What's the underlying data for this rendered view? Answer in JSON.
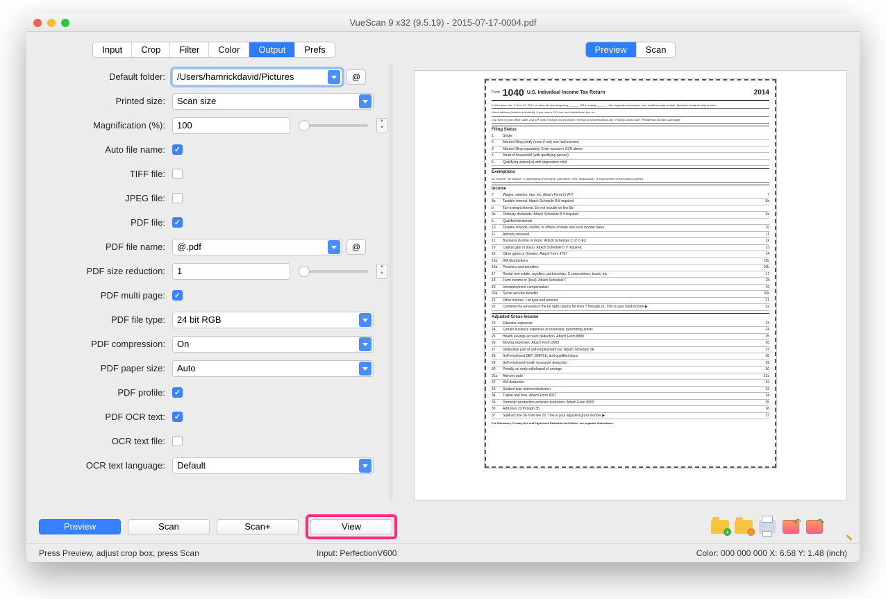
{
  "window": {
    "title": "VueScan 9 x32 (9.5.19) - 2015-07-17-0004.pdf"
  },
  "left_tabs": [
    "Input",
    "Crop",
    "Filter",
    "Color",
    "Output",
    "Prefs"
  ],
  "left_tab_active": 4,
  "right_tabs": [
    "Preview",
    "Scan"
  ],
  "right_tab_active": 0,
  "form": {
    "default_folder": {
      "label": "Default folder:",
      "value": "/Users/hamrickdavid/Pictures"
    },
    "printed_size": {
      "label": "Printed size:",
      "value": "Scan size"
    },
    "magnification": {
      "label": "Magnification (%):",
      "value": "100"
    },
    "auto_file_name": {
      "label": "Auto file name:",
      "checked": true
    },
    "tiff_file": {
      "label": "TIFF file:",
      "checked": false
    },
    "jpeg_file": {
      "label": "JPEG file:",
      "checked": false
    },
    "pdf_file": {
      "label": "PDF file:",
      "checked": true
    },
    "pdf_file_name": {
      "label": "PDF file name:",
      "value": "@.pdf"
    },
    "pdf_size_red": {
      "label": "PDF size reduction:",
      "value": "1"
    },
    "pdf_multi_page": {
      "label": "PDF multi page:",
      "checked": true
    },
    "pdf_file_type": {
      "label": "PDF file type:",
      "value": "24 bit RGB"
    },
    "pdf_compress": {
      "label": "PDF compression:",
      "value": "On"
    },
    "pdf_paper_size": {
      "label": "PDF paper size:",
      "value": "Auto"
    },
    "pdf_profile": {
      "label": "PDF profile:",
      "checked": true
    },
    "pdf_ocr_text": {
      "label": "PDF OCR text:",
      "checked": true
    },
    "ocr_text_file": {
      "label": "OCR text file:",
      "checked": false
    },
    "ocr_lang": {
      "label": "OCR text language:",
      "value": "Default"
    }
  },
  "buttons": {
    "preview": "Preview",
    "scan": "Scan",
    "scanplus": "Scan+",
    "view": "View"
  },
  "status": {
    "left": "Press Preview, adjust crop box, press Scan",
    "mid": "Input: PerfectionV600",
    "right": "Color: 000 000 000    X:   6.58   Y:   1.48 (inch)"
  },
  "doc": {
    "form_no": "1040",
    "title": "U.S. Individual Income Tax Return",
    "year": "2014",
    "sections": {
      "filing": "Filing Status",
      "exemptions": "Exemptions",
      "income": "Income",
      "agi": "Adjusted Gross Income"
    },
    "filing_opts": [
      "Single",
      "Married filing jointly (even if only one had income)",
      "Married filing separately. Enter spouse's SSN above",
      "Head of household (with qualifying person)",
      "Qualifying widow(er) with dependent child"
    ],
    "income_lines": [
      [
        "7",
        "Wages, salaries, tips, etc. Attach Form(s) W-2",
        "7"
      ],
      [
        "8a",
        "Taxable interest. Attach Schedule B if required",
        "8a"
      ],
      [
        "b",
        "Tax-exempt interest. Do not include on line 8a",
        ""
      ],
      [
        "9a",
        "Ordinary dividends. Attach Schedule B if required",
        "9a"
      ],
      [
        "b",
        "Qualified dividends",
        ""
      ],
      [
        "10",
        "Taxable refunds, credits, or offsets of state and local income taxes",
        "10"
      ],
      [
        "11",
        "Alimony received",
        "11"
      ],
      [
        "12",
        "Business income or (loss). Attach Schedule C or C-EZ",
        "12"
      ],
      [
        "13",
        "Capital gain or (loss). Attach Schedule D if required.",
        "13"
      ],
      [
        "14",
        "Other gains or (losses). Attach Form 4797",
        "14"
      ],
      [
        "15a",
        "IRA distributions",
        "15b"
      ],
      [
        "16a",
        "Pensions and annuities",
        "16b"
      ],
      [
        "17",
        "Rental real estate, royalties, partnerships, S corporations, trusts, etc.",
        "17"
      ],
      [
        "18",
        "Farm income or (loss). Attach Schedule F",
        "18"
      ],
      [
        "19",
        "Unemployment compensation",
        "19"
      ],
      [
        "20a",
        "Social security benefits",
        "20b"
      ],
      [
        "21",
        "Other income. List type and amount",
        "21"
      ],
      [
        "22",
        "Combine the amounts in the far right column for lines 7 through 21. This is your total income ▶",
        "22"
      ]
    ],
    "agi_lines": [
      [
        "23",
        "Educator expenses",
        "23"
      ],
      [
        "24",
        "Certain business expenses of reservists, performing artists",
        "24"
      ],
      [
        "25",
        "Health savings account deduction. Attach Form 8889",
        "25"
      ],
      [
        "26",
        "Moving expenses. Attach Form 3903",
        "26"
      ],
      [
        "27",
        "Deductible part of self-employment tax. Attach Schedule SE",
        "27"
      ],
      [
        "28",
        "Self-employed SEP, SIMPLE, and qualified plans",
        "28"
      ],
      [
        "29",
        "Self-employed health insurance deduction",
        "29"
      ],
      [
        "30",
        "Penalty on early withdrawal of savings",
        "30"
      ],
      [
        "31a",
        "Alimony paid",
        "31a"
      ],
      [
        "32",
        "IRA deduction",
        "32"
      ],
      [
        "33",
        "Student loan interest deduction",
        "33"
      ],
      [
        "34",
        "Tuition and fees. Attach Form 8917",
        "34"
      ],
      [
        "35",
        "Domestic production activities deduction. Attach Form 8903",
        "35"
      ],
      [
        "36",
        "Add lines 23 through 35",
        "36"
      ],
      [
        "37",
        "Subtract line 36 from line 22. This is your adjusted gross income ▶",
        "37"
      ]
    ],
    "footer": "For Disclosure, Privacy Act, and Paperwork Reduction Act Notice, see separate instructions."
  },
  "at_symbol": "@"
}
